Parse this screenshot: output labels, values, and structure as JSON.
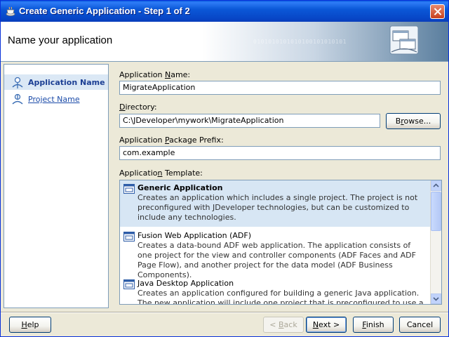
{
  "window": {
    "title": "Create Generic Application - Step 1 of 2",
    "title_icon": "jdeveloper-cup-icon",
    "close_icon": "close-icon"
  },
  "header": {
    "title": "Name your application",
    "binary_text": "0101010101010100101010101",
    "icon": "application-windows-icon"
  },
  "nav": {
    "items": [
      {
        "label": "Application Name",
        "state": "selected",
        "icon": "person-step-icon"
      },
      {
        "label": "Project Name",
        "state": "link",
        "icon": "person-step-icon"
      }
    ]
  },
  "form": {
    "app_name_label_pre": "Application ",
    "app_name_label_key": "N",
    "app_name_label_post": "ame:",
    "app_name_value": "MigrateApplication",
    "directory_label_key": "D",
    "directory_label_post": "irectory:",
    "directory_value": "C:\\JDeveloper\\mywork\\MigrateApplication",
    "browse_label_pre": "B",
    "browse_label_key": "r",
    "browse_label_post": "owse...",
    "package_label_pre": "Application ",
    "package_label_key": "P",
    "package_label_post": "ackage Prefix:",
    "package_value": "com.example",
    "template_label_pre": "Applicatio",
    "template_label_key": "n",
    "template_label_post": " Template:"
  },
  "templates": [
    {
      "title": "Generic Application",
      "description": "Creates an application which includes a single project. The project is not preconfigured with JDeveloper technologies, but can be customized to include any technologies.",
      "selected": true
    },
    {
      "title": "Fusion Web Application (ADF)",
      "description": "Creates a data-bound ADF web application. The application consists of one project for the view and controller components (ADF Faces and ADF Page Flow), and another project for the data model (ADF Business Components).",
      "selected": false
    },
    {
      "title": "Java Desktop Application",
      "description": "Creates an application configured for building a generic Java application. The new application will include one project that is preconfigured to use a Java Swing and",
      "selected": false
    }
  ],
  "footer": {
    "help_key": "H",
    "help_post": "elp",
    "back_pre": "< ",
    "back_key": "B",
    "back_post": "ack",
    "next_key": "N",
    "next_post": "ext >",
    "finish_key": "F",
    "finish_post": "inish",
    "cancel_label": "Cancel"
  },
  "colors": {
    "title_bar": "#0a58d8",
    "dialog_bg": "#ece9d8",
    "selection": "#d7e6f4",
    "link": "#1a4aa8"
  }
}
